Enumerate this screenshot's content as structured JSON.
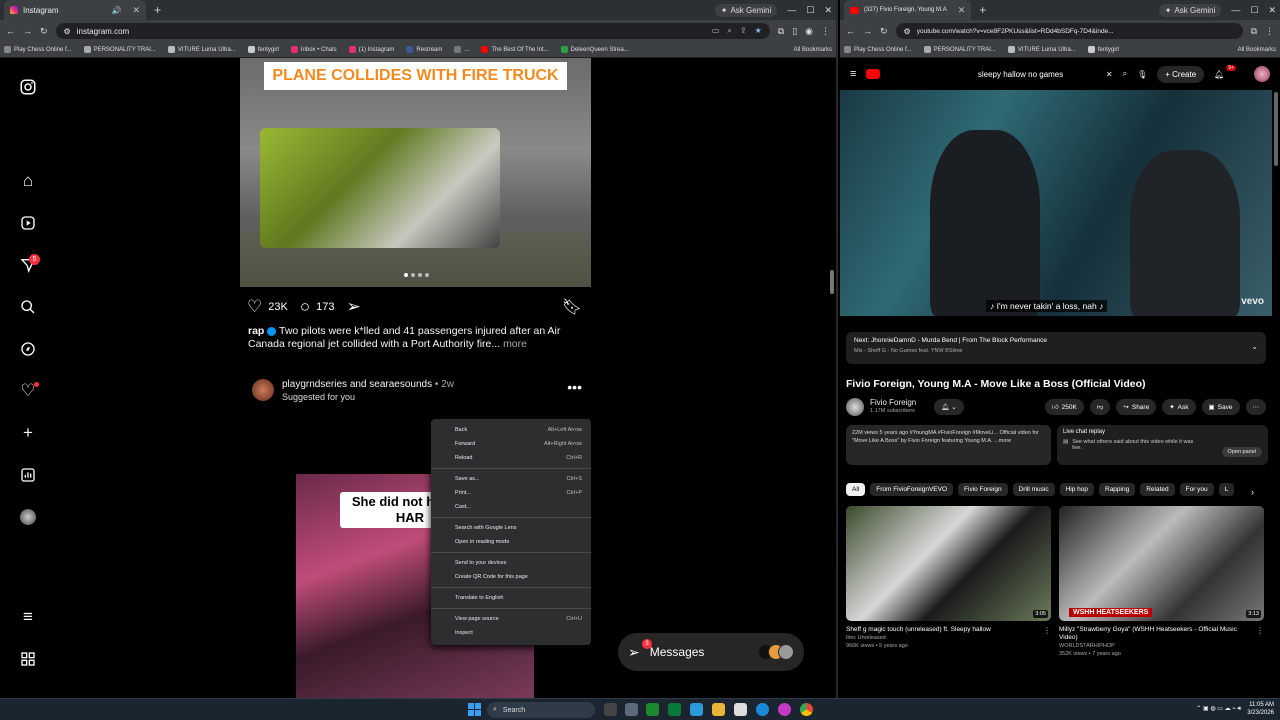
{
  "left_window": {
    "tab_title": "Instagram",
    "url": "instagram.com",
    "ask_gemini": "Ask Gemini",
    "bookmarks": [
      "Play Chess Online f...",
      "PERSONALITY TRAI...",
      "VITURE Luma Ultra...",
      "fentygirl",
      "Inbox • Chats",
      "(1) Instagram",
      "Restream",
      "...",
      "The Best Of The Int...",
      "DeleenQueen Strea..."
    ],
    "all_bookmarks": "All Bookmarks"
  },
  "instagram": {
    "notifications_badge": "5",
    "post1": {
      "image_caption": "PLANE COLLIDES WITH FIRE TRUCK",
      "likes": "23K",
      "comments": "173",
      "author": "rap",
      "caption": "Two pilots were k*lled and 41 passengers injured after an Air Canada regional jet collided with a Port Authority fire...",
      "more": "more"
    },
    "post2": {
      "authors": "playgrndseries and searaesounds",
      "time": "2w",
      "suggested": "Suggested for you",
      "video_text": "She did not ha this HAR"
    },
    "messages": {
      "label": "Messages",
      "badge": "3"
    }
  },
  "context_menu": {
    "items": [
      {
        "label": "Back",
        "shortcut": "Alt+Left Arrow"
      },
      {
        "label": "Forward",
        "shortcut": "Alt+Right Arrow"
      },
      {
        "label": "Reload",
        "shortcut": "Ctrl+R"
      },
      {
        "label": "Save as...",
        "shortcut": "Ctrl+S"
      },
      {
        "label": "Print...",
        "shortcut": "Ctrl+P"
      },
      {
        "label": "Cast...",
        "shortcut": ""
      },
      {
        "label": "Search with Google Lens",
        "shortcut": ""
      },
      {
        "label": "Open in reading mode",
        "shortcut": ""
      },
      {
        "label": "Send to your devices",
        "shortcut": ""
      },
      {
        "label": "Create QR Code for this page",
        "shortcut": ""
      },
      {
        "label": "Translate to English",
        "shortcut": ""
      },
      {
        "label": "View page source",
        "shortcut": "Ctrl+U"
      },
      {
        "label": "Inspect",
        "shortcut": ""
      }
    ]
  },
  "right_window": {
    "tab_title": "(327) Fivio Foreign, Young M.A",
    "url": "youtube.com/watch?v=vce8F2PKUss&list=RDd4bSDFq-7D4&inde...",
    "ask_gemini": "Ask Gemini",
    "bookmarks": [
      "Play Chess Online f...",
      "PERSONALITY TRAI...",
      "VITURE Luma Ultra...",
      "fentygirl"
    ],
    "all_bookmarks": "All Bookmarks"
  },
  "youtube": {
    "search_query": "sleepy hallow no games",
    "create": "Create",
    "notif_badge": "9+",
    "subtitle": "♪ I'm never takin' a loss, nah ♪",
    "vevo": "vevo",
    "next_title": "Next: JhonnieDamnD - Murda Bend | From The Block Performance",
    "next_sub": "Mix - Sheff G - No Games feat. YNW BSlime",
    "video_title": "Fivio Foreign, Young M.A - Move Like a Boss (Official Video)",
    "channel": "Fivio Foreign",
    "subs": "1.17M subscribers",
    "likes": "250K",
    "share": "Share",
    "ask": "Ask",
    "save": "Save",
    "description": "22M views  5 years ago  #YoungMA #FivioForeign #MoveLi... Official video for \"Move Like A Boss\" by Fivio Foreign featuring Young M.A. ...more",
    "live_chat_title": "Live chat replay",
    "live_chat_text": "See what others said about this video while it was live.",
    "open_panel": "Open panel",
    "chips": [
      "All",
      "From FivioForeignVEVO",
      "Fivio Foreign",
      "Drill music",
      "Hip hop",
      "Rapping",
      "Related",
      "For you",
      "L"
    ],
    "cards": [
      {
        "title": "Sheff g magic touch (unreleased) ft. Sleepy hallow",
        "channel": "Ilmc Unreleased",
        "meta": "966K views • 5 years ago",
        "duration": "3:05"
      },
      {
        "title": "Millyz \"Strawberry Goya\" (WSHH Heatseekers - Official Music Video)",
        "channel": "WORLDSTARHIPHOP",
        "meta": "352K views • 7 years ago",
        "duration": "3:13",
        "overlay": "WSHH HEATSEEKERS"
      }
    ]
  },
  "taskbar": {
    "search": "Search",
    "time": "11:05 AM",
    "date": "3/23/2026"
  }
}
